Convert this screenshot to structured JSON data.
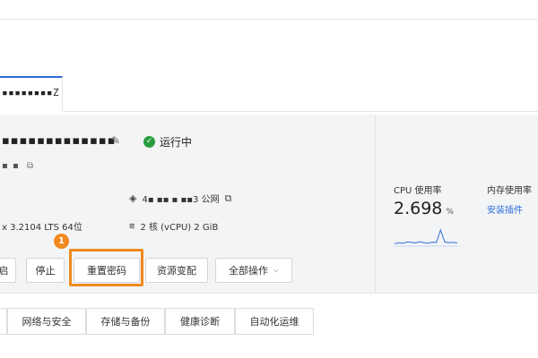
{
  "instance_tab": {
    "label": "▪▪▪▪▪▪▪▪Z"
  },
  "instance": {
    "name": "▪▪▪▪▪▪▪▪▪▪▪▪▪",
    "status_text": "运行中",
    "sub_id": "▪ ▪",
    "ip_text": "4▪ ▪▪ ▪ ▪▪3 公网",
    "os_text": "x 3.2104 LTS 64位",
    "spec_text": "2 核 (vCPU) 2 GiB"
  },
  "actions": {
    "partial_label": "启",
    "stop_label": "停止",
    "reset_password_label": "重置密码",
    "resize_label": "资源变配",
    "all_actions_label": "全部操作"
  },
  "callout": {
    "number": "1"
  },
  "metrics": {
    "cpu_label": "CPU 使用率",
    "cpu_value": "2.698",
    "cpu_unit": "%",
    "mem_label": "内存使用率",
    "mem_link": "安装插件",
    "cpu_sparkline": [
      0.1,
      0.15,
      0.12,
      0.2,
      0.18,
      0.14,
      0.22,
      0.16,
      0.13,
      0.19,
      0.17,
      0.95,
      0.2,
      0.15,
      0.18,
      0.14
    ]
  },
  "bottom_tabs": {
    "partial": "",
    "network_security": "网络与安全",
    "storage_backup": "存储与备份",
    "health_diagnosis": "健康诊断",
    "automation_ops": "自动化运维"
  },
  "colors": {
    "accent": "#2f6fd6",
    "highlight": "#f08a1e",
    "success": "#2a9d3f"
  }
}
